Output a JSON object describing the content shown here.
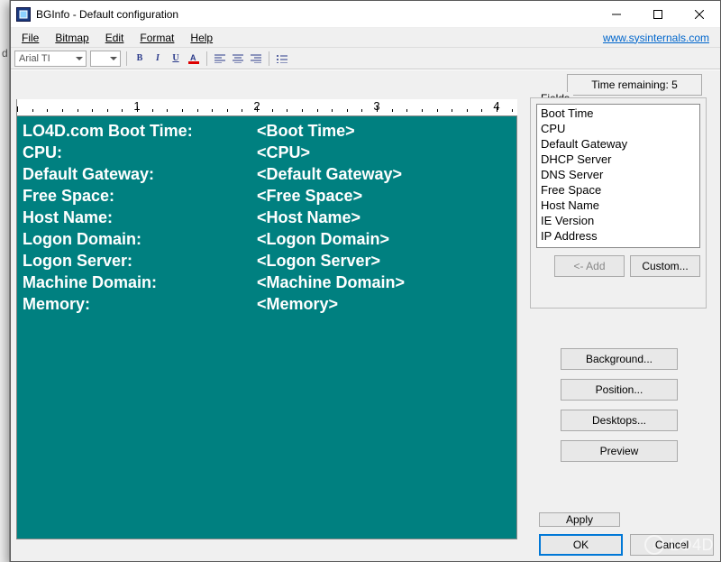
{
  "titlebar": {
    "title": "BGInfo - Default configuration"
  },
  "menu": {
    "file": "File",
    "bitmap": "Bitmap",
    "edit": "Edit",
    "format": "Format",
    "help": "Help",
    "link": "www.sysinternals.com"
  },
  "toolbar": {
    "font": "Arial TI"
  },
  "time_remaining": "Time remaining: 5",
  "ruler": {
    "nums": [
      "1",
      "2",
      "3",
      "4"
    ]
  },
  "editor": {
    "rows": [
      {
        "label": "LO4D.com Boot Time:",
        "val": "<Boot Time>"
      },
      {
        "label": "CPU:",
        "val": "<CPU>"
      },
      {
        "label": "Default Gateway:",
        "val": "<Default Gateway>"
      },
      {
        "label": "Free Space:",
        "val": "<Free Space>"
      },
      {
        "label": "Host Name:",
        "val": "<Host Name>"
      },
      {
        "label": "Logon Domain:",
        "val": "<Logon Domain>"
      },
      {
        "label": "Logon Server:",
        "val": "<Logon Server>"
      },
      {
        "label": "Machine Domain:",
        "val": "<Machine Domain>"
      },
      {
        "label": "Memory:",
        "val": "<Memory>"
      }
    ]
  },
  "fields": {
    "label": "Fields",
    "items": [
      "Boot Time",
      "CPU",
      "Default Gateway",
      "DHCP Server",
      "DNS Server",
      "Free Space",
      "Host Name",
      "IE Version",
      "IP Address"
    ],
    "add": "<- Add",
    "custom": "Custom..."
  },
  "side": {
    "background": "Background...",
    "position": "Position...",
    "desktops": "Desktops...",
    "preview": "Preview"
  },
  "bottom": {
    "apply": "Apply",
    "ok": "OK",
    "cancel": "Cancel"
  },
  "watermark": "LO4D"
}
